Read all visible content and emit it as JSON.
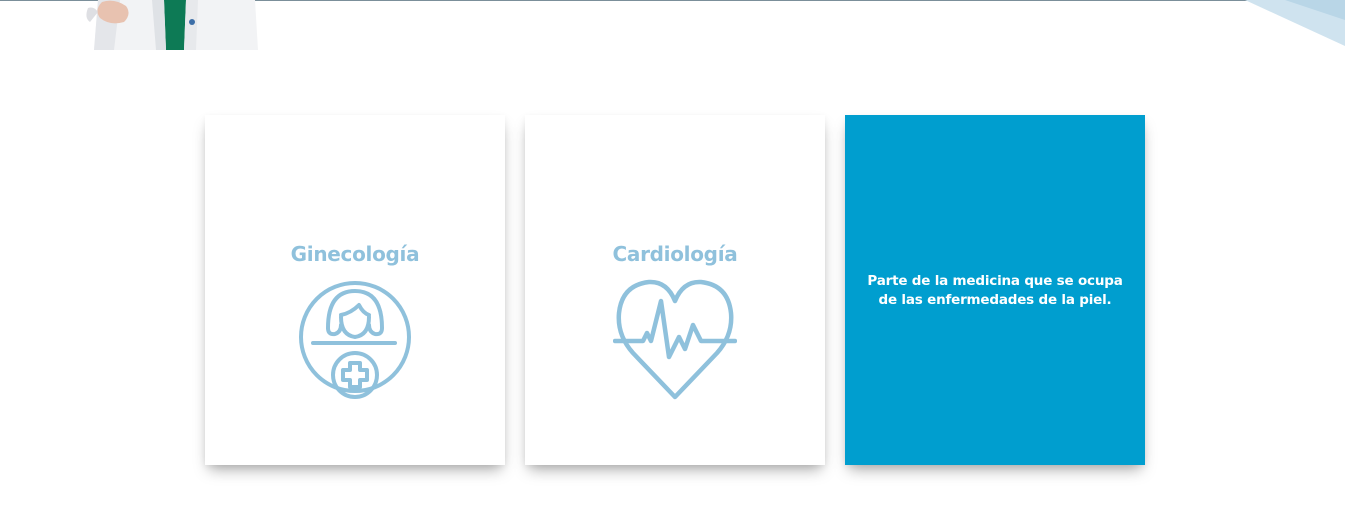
{
  "specialties": [
    {
      "title": "Ginecología",
      "icon": "woman-medical-icon",
      "description": ""
    },
    {
      "title": "Cardiología",
      "icon": "heart-pulse-icon",
      "description": ""
    },
    {
      "title": "",
      "icon": "",
      "description": "Parte de la medicina que se ocupa de las enfermedades de la piel."
    }
  ],
  "colors": {
    "icon_blue": "#8fc1dc",
    "active_card": "#009ecf",
    "card_bg": "#ffffff"
  }
}
